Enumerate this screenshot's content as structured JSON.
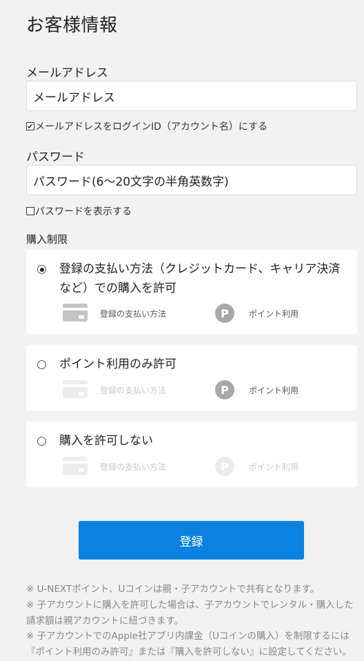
{
  "page_title": "お客様情報",
  "email": {
    "label": "メールアドレス",
    "placeholder": "メールアドレス",
    "checkbox_label": "メールアドレスをログインID（アカウント名）にする",
    "checked": true
  },
  "password": {
    "label": "パスワード",
    "placeholder": "パスワード(6〜20文字の半角英数字)",
    "checkbox_label": "パスワードを表示する",
    "checked": false
  },
  "purchase": {
    "label": "購入制限",
    "card_icon_label": "登録の支払い方法",
    "point_icon_label": "ポイント利用",
    "point_glyph": "P",
    "options": [
      {
        "text": "登録の支払い方法（クレジットカード、キャリア決済など）での購入を許可",
        "selected": true
      },
      {
        "text": "ポイント利用のみ許可",
        "selected": false
      },
      {
        "text": "購入を許可しない",
        "selected": false
      }
    ]
  },
  "submit_label": "登録",
  "notes": [
    "※ U-NEXTポイント、Uコインは親・子アカウントで共有となります。",
    "※ 子アカウントに購入を許可した場合は、子アカウントでレンタル・購入した請求額は親アカウントに紐づきます。",
    "※ 子アカウントでのApple社アプリ内課金（Uコインの購入）を制限するには『ポイント利用のみ許可』または『購入を許可しない』に設定してください。"
  ],
  "colors": {
    "accent": "#0b82e0",
    "icon_active": "#c4c4c4",
    "icon_active_point": "#a8a8a8",
    "icon_disabled": "#ececec",
    "text_active": "#555555",
    "text_disabled": "#c8c8c8"
  }
}
